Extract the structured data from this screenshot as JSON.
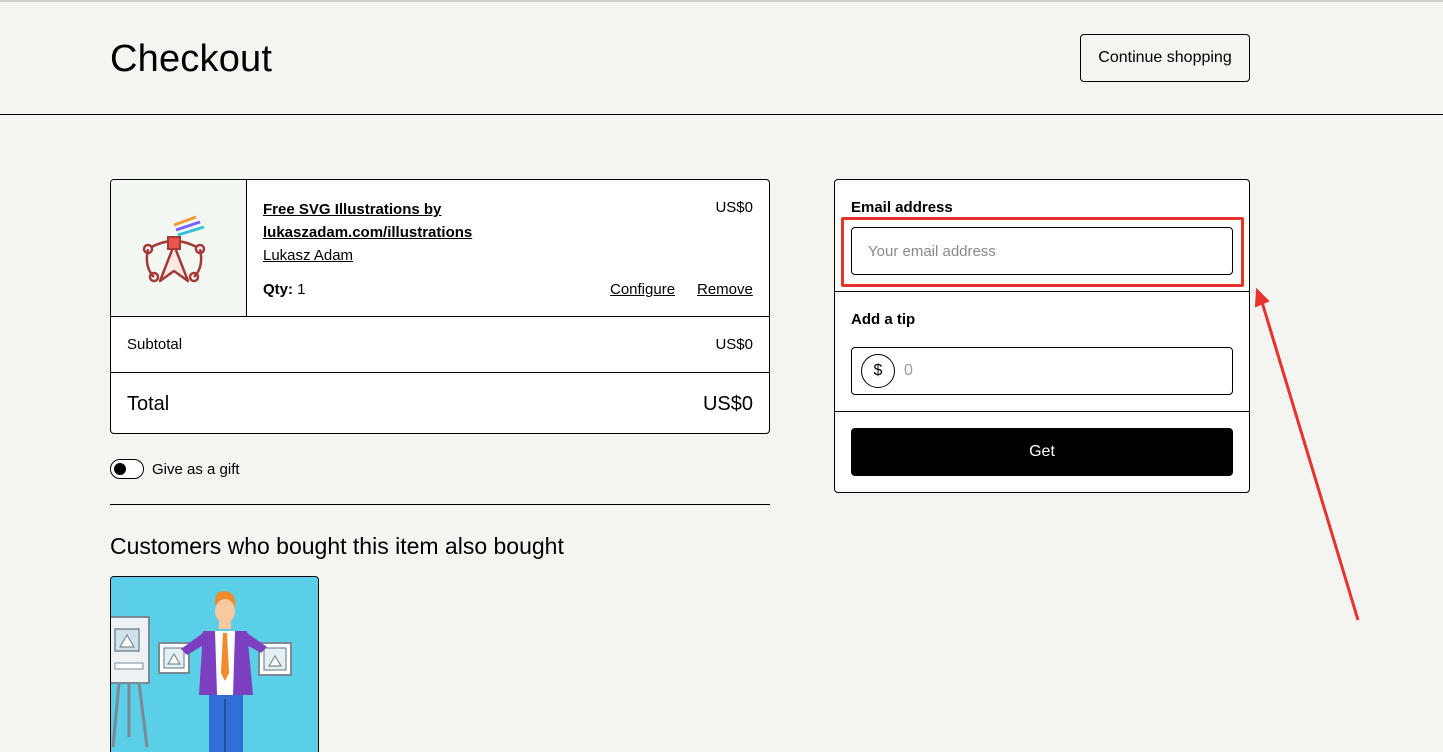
{
  "header": {
    "title": "Checkout",
    "continue_label": "Continue shopping"
  },
  "cart": {
    "item": {
      "title": "Free SVG Illustrations by lukaszadam.com/illustrations",
      "author": "Lukasz Adam",
      "qty_label": "Qty:",
      "qty_value": "1",
      "price": "US$0",
      "configure_label": "Configure",
      "remove_label": "Remove"
    },
    "subtotal_label": "Subtotal",
    "subtotal_value": "US$0",
    "total_label": "Total",
    "total_value": "US$0"
  },
  "gift": {
    "label": "Give as a gift",
    "enabled": false
  },
  "recommendations": {
    "title": "Customers who bought this item also bought"
  },
  "checkout": {
    "email_label": "Email address",
    "email_placeholder": "Your email address",
    "email_value": "",
    "tip_label": "Add a tip",
    "tip_currency": "$",
    "tip_placeholder": "0",
    "get_label": "Get"
  },
  "annotation": {
    "color": "#e8322d",
    "target": "email-input"
  }
}
